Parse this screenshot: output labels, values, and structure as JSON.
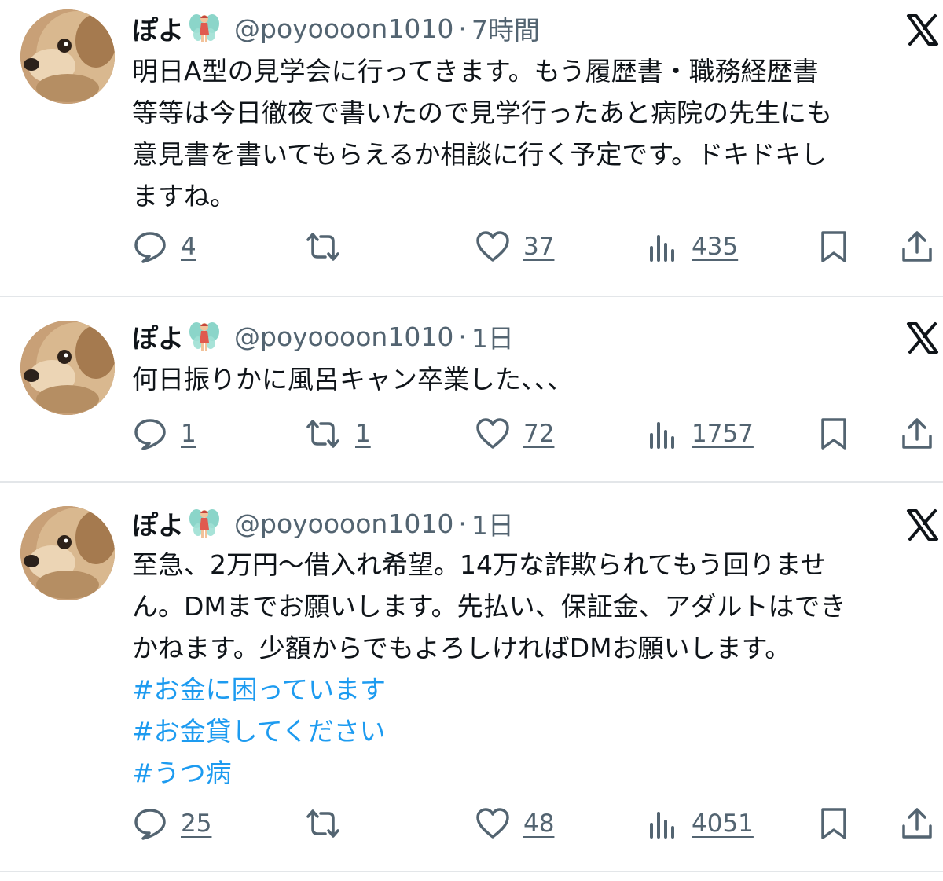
{
  "colors": {
    "text": "#0f1419",
    "muted": "#536471",
    "hashtag": "#1d9bf0",
    "divider": "#e3e6e9"
  },
  "tweets": [
    {
      "name": "ぽよ",
      "name_emoji": "fairy-icon",
      "handle": "@poyoooon1010",
      "dot": "·",
      "time": "7時間",
      "lines": [
        "明日A型の見学会に行ってきます。もう履歴書・職務経歴書",
        "等等は今日徹夜で書いたので見学行ったあと病院の先生にも",
        "意見書を書いてもらえるか相談に行く予定です。ドキドキし",
        "ますね。"
      ],
      "hashtags": [],
      "reply_count": "4",
      "retweet_count": "",
      "like_count": "37",
      "view_count": "435"
    },
    {
      "name": "ぽよ",
      "name_emoji": "fairy-icon",
      "handle": "@poyoooon1010",
      "dot": "·",
      "time": "1日",
      "lines": [
        "何日振りかに風呂キャン卒業した、、、"
      ],
      "hashtags": [],
      "reply_count": "1",
      "retweet_count": "1",
      "like_count": "72",
      "view_count": "1757"
    },
    {
      "name": "ぽよ",
      "name_emoji": "fairy-icon",
      "handle": "@poyoooon1010",
      "dot": "·",
      "time": "1日",
      "lines": [
        "至急、2万円〜借入れ希望。14万な詐欺られてもう回りませ",
        "ん。DMまでお願いします。先払い、保証金、アダルトはでき",
        "かねます。少額からでもよろしければDMお願いします。"
      ],
      "hashtags": [
        "#お金に困っています",
        "#お金貸してください",
        "#うつ病"
      ],
      "reply_count": "25",
      "retweet_count": "",
      "like_count": "48",
      "view_count": "4051"
    }
  ]
}
